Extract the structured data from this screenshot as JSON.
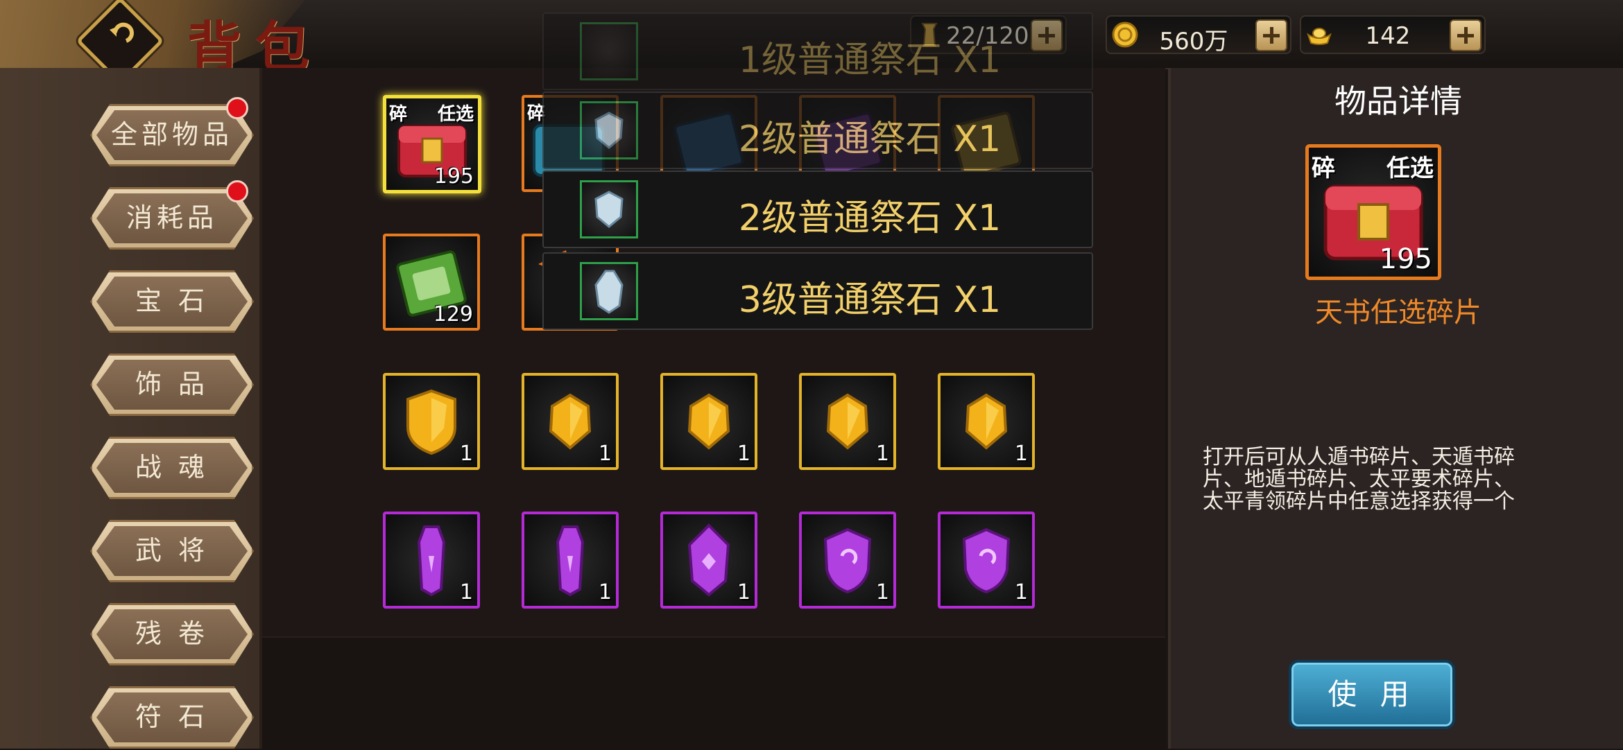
{
  "header": {
    "title": "背包",
    "resources": [
      {
        "icon": "bag-capacity-icon",
        "value": "22/120"
      },
      {
        "icon": "gold-coin-icon",
        "value": "560万"
      },
      {
        "icon": "gold-ingot-icon",
        "value": "142"
      }
    ]
  },
  "sidebar": {
    "items": [
      {
        "label": "全部物品",
        "badge": true
      },
      {
        "label": "消耗品",
        "badge": true
      },
      {
        "label": "宝 石",
        "badge": false
      },
      {
        "label": "饰 品",
        "badge": false
      },
      {
        "label": "战 魂",
        "badge": false
      },
      {
        "label": "武 将",
        "badge": false
      },
      {
        "label": "残 卷",
        "badge": false
      },
      {
        "label": "符 石",
        "badge": false
      }
    ]
  },
  "grid": {
    "row1": [
      {
        "name": "天书任选碎片",
        "count": "195",
        "tag_left": "碎",
        "tag_right": "任选",
        "rarity": "orange",
        "selected": true
      },
      {
        "name": "碎片宝箱",
        "count": "",
        "tag_left": "碎",
        "rarity": "orange"
      },
      {
        "name": "蓝色书卷",
        "count": "",
        "rarity": "orange"
      },
      {
        "name": "紫色书卷",
        "count": "",
        "rarity": "orange"
      },
      {
        "name": "黄色书卷",
        "count": "",
        "rarity": "orange"
      }
    ],
    "row2": [
      {
        "name": "绿色书卷",
        "count": "129",
        "rarity": "orange"
      },
      {
        "name": "物品",
        "count": "",
        "rarity": "orange"
      }
    ],
    "gold_stones": [
      "1",
      "1",
      "1",
      "1",
      "1"
    ],
    "purple_stones": [
      "1",
      "1",
      "1",
      "1",
      "1"
    ]
  },
  "popups": [
    {
      "text": "1级普通祭石 X1"
    },
    {
      "text": "2级普通祭石 X1"
    },
    {
      "text": "2级普通祭石 X1"
    },
    {
      "text": "3级普通祭石 X1"
    }
  ],
  "details": {
    "title": "物品详情",
    "item_name": "天书任选碎片",
    "item_count": "195",
    "tag_left": "碎",
    "tag_right": "任选",
    "description": "打开后可从人遁书碎片、天遁书碎片、地遁书碎片、太平要术碎片、太平青领碎片中任意选择获得一个",
    "use_button": "使 用"
  },
  "colors": {
    "orange_border": "#e67a1e",
    "gold_border": "#e3b32a",
    "purple_border": "#b42ad6",
    "popup_text": "#f2d06a",
    "item_name": "#f08a2a"
  }
}
